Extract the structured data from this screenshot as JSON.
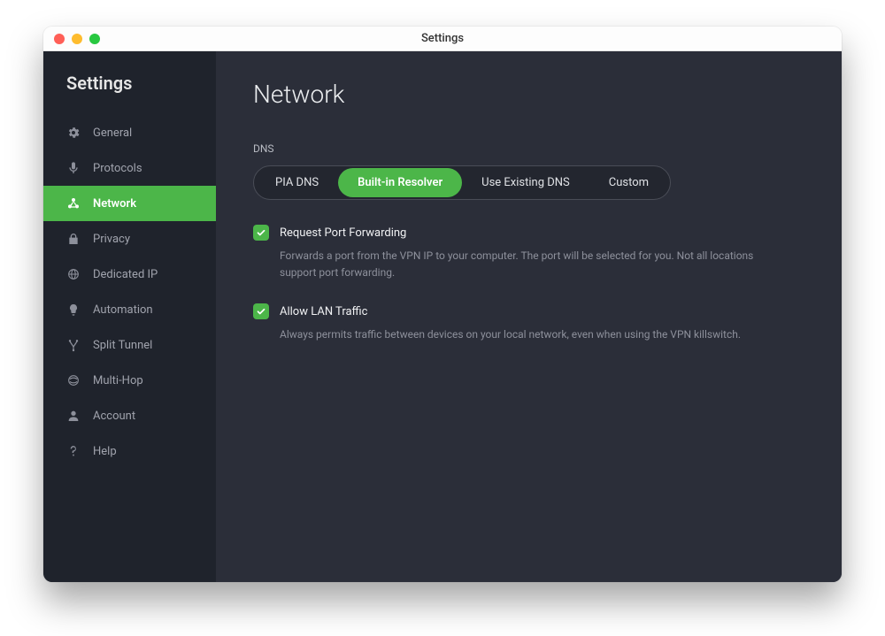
{
  "window": {
    "title": "Settings"
  },
  "sidebar": {
    "title": "Settings",
    "items": [
      {
        "label": "General",
        "icon": "gear-icon"
      },
      {
        "label": "Protocols",
        "icon": "mic-icon"
      },
      {
        "label": "Network",
        "icon": "network-icon"
      },
      {
        "label": "Privacy",
        "icon": "lock-icon"
      },
      {
        "label": "Dedicated IP",
        "icon": "globe-ip-icon"
      },
      {
        "label": "Automation",
        "icon": "bulb-icon"
      },
      {
        "label": "Split Tunnel",
        "icon": "fork-icon"
      },
      {
        "label": "Multi-Hop",
        "icon": "multihop-icon"
      },
      {
        "label": "Account",
        "icon": "user-icon"
      },
      {
        "label": "Help",
        "icon": "question-icon"
      }
    ],
    "selected_index": 2
  },
  "page": {
    "title": "Network",
    "dns_label": "DNS",
    "dns_options": [
      {
        "label": "PIA DNS"
      },
      {
        "label": "Built-in Resolver"
      },
      {
        "label": "Use Existing DNS"
      },
      {
        "label": "Custom"
      }
    ],
    "dns_selected_index": 1,
    "port_forwarding": {
      "checked": true,
      "label": "Request Port Forwarding",
      "description": "Forwards a port from the VPN IP to your computer. The port will be selected for you. Not all locations support port forwarding."
    },
    "lan_traffic": {
      "checked": true,
      "label": "Allow LAN Traffic",
      "description": "Always permits traffic between devices on your local network, even when using the VPN killswitch."
    }
  }
}
